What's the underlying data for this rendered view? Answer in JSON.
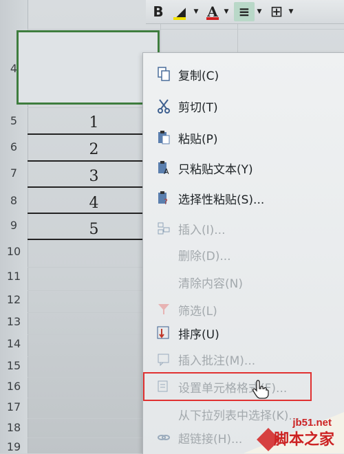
{
  "toolbar": {
    "bold_label": "B",
    "font_color_label": "A",
    "align_icon": "align-center-icon",
    "border_icon": "borders-icon",
    "fill_color": "#f0e000",
    "font_color": "#d21f1f"
  },
  "row_numbers": [
    "4",
    "5",
    "6",
    "7",
    "8",
    "9",
    "10",
    "11",
    "12",
    "13",
    "14",
    "15",
    "16",
    "17",
    "18",
    "19"
  ],
  "cells": [
    "1",
    "2",
    "3",
    "4",
    "5"
  ],
  "context_menu": {
    "items": [
      {
        "label": "复制(C)",
        "icon": "copy-icon",
        "enabled": true
      },
      {
        "label": "剪切(T)",
        "icon": "scissors-icon",
        "enabled": true
      },
      {
        "label": "粘贴(P)",
        "icon": "paste-icon",
        "enabled": true
      },
      {
        "label": "只粘贴文本(Y)",
        "icon": "paste-text-icon",
        "enabled": true
      },
      {
        "label": "选择性粘贴(S)...",
        "icon": "paste-special-icon",
        "enabled": true
      },
      {
        "label": "插入(I)...",
        "icon": "insert-icon",
        "enabled": false
      },
      {
        "label": "删除(D)...",
        "icon": "",
        "enabled": false
      },
      {
        "label": "清除内容(N)",
        "icon": "",
        "enabled": false
      },
      {
        "label": "筛选(L)",
        "icon": "filter-icon",
        "enabled": false
      },
      {
        "label": "排序(U)",
        "icon": "sort-icon",
        "enabled": true
      },
      {
        "label": "插入批注(M)...",
        "icon": "comment-icon",
        "enabled": false
      },
      {
        "label": "设置单元格格式(F)...",
        "icon": "format-cells-icon",
        "enabled": false
      },
      {
        "label": "从下拉列表中选择(K)...",
        "icon": "",
        "enabled": false
      },
      {
        "label": "超链接(H)...",
        "icon": "hyperlink-icon",
        "enabled": false
      }
    ],
    "highlight_color": "#e03030"
  },
  "watermark": {
    "logo": "jb51.net",
    "text": "脚本之家"
  }
}
